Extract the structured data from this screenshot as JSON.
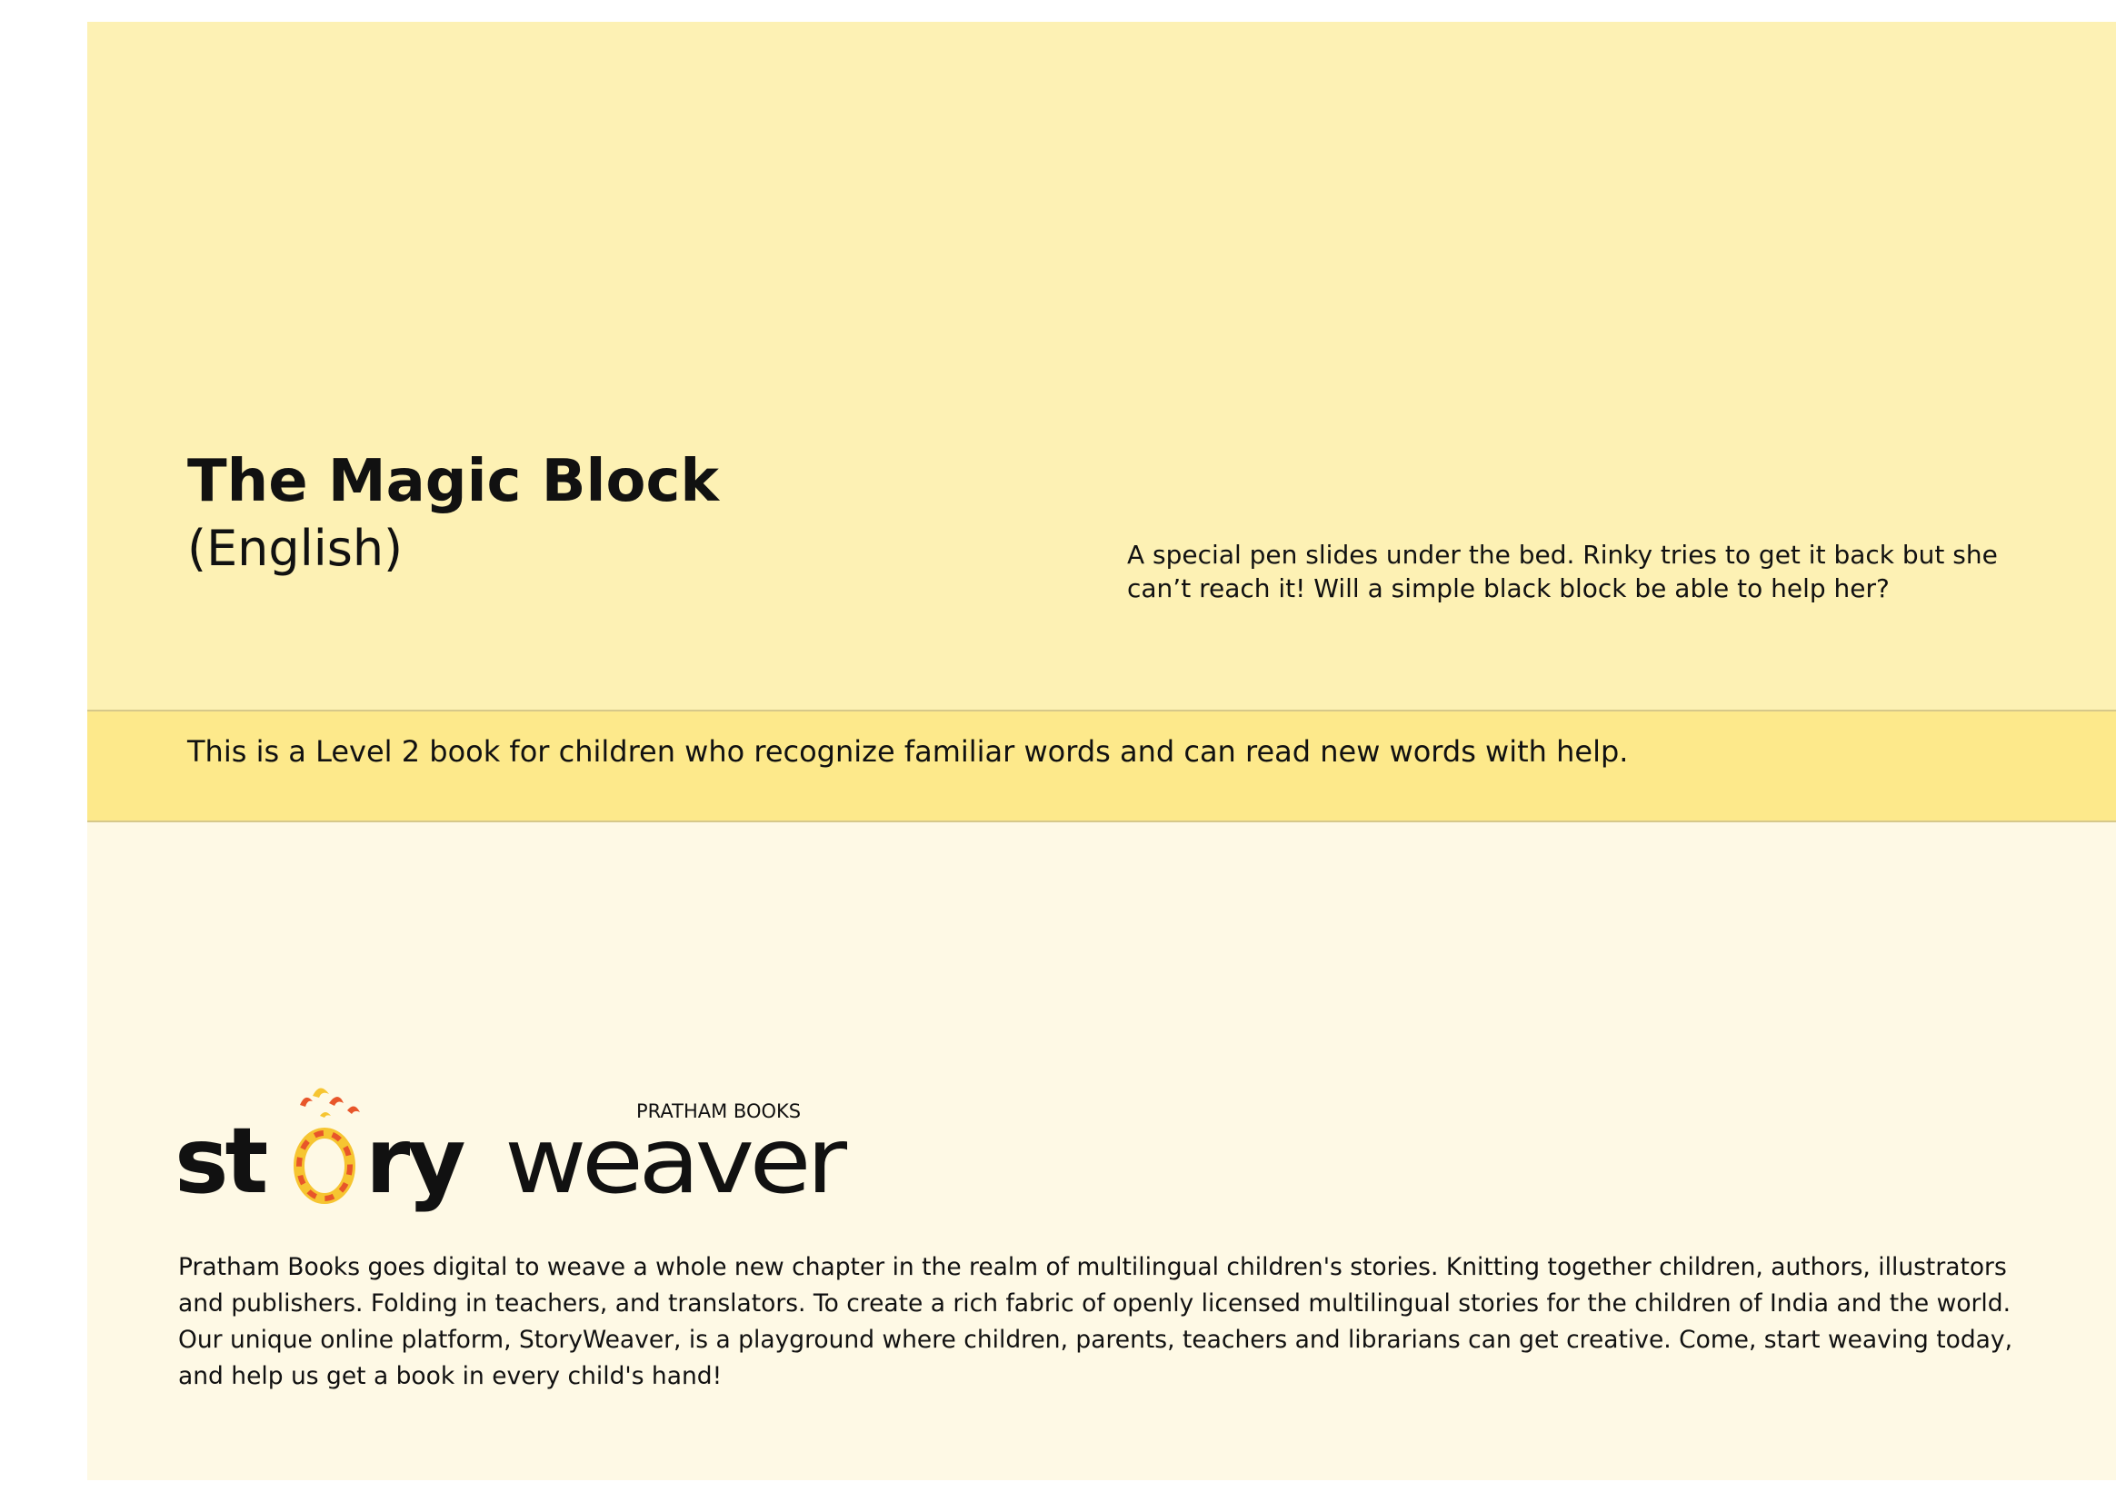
{
  "book": {
    "title": "The Magic Block",
    "language": "(English)",
    "synopsis": "A special pen slides under the bed. Rinky tries to get it back but she can’t reach it! Will a simple black block be able to help her?"
  },
  "level": {
    "text": "This is a Level 2 book for children who recognize familiar words and can read new words with help."
  },
  "publisher": {
    "logo": {
      "publisher_name": "PRATHAM BOOKS",
      "wordmark_bold": "st",
      "wordmark_bold_2": "ry",
      "wordmark_light": "weaver",
      "icon": "yarn-ring-icon"
    },
    "about": "Pratham Books goes digital to weave a whole new chapter in the realm of multilingual children's stories. Knitting together children, authors, illustrators and publishers. Folding in teachers, and translators. To create a rich fabric of openly licensed multilingual stories for the children of India  and the world. Our unique online platform, StoryWeaver, is a playground where children, parents, teachers and librarians can get creative. Come, start weaving today, and help us get a book in every child's hand!"
  },
  "colors": {
    "top_panel": "#fdf1b4",
    "level_band": "#fde98b",
    "bottom_panel": "#fef9e5",
    "logo_orange": "#e8562a",
    "logo_yellow": "#f6c531",
    "text": "#111111"
  }
}
